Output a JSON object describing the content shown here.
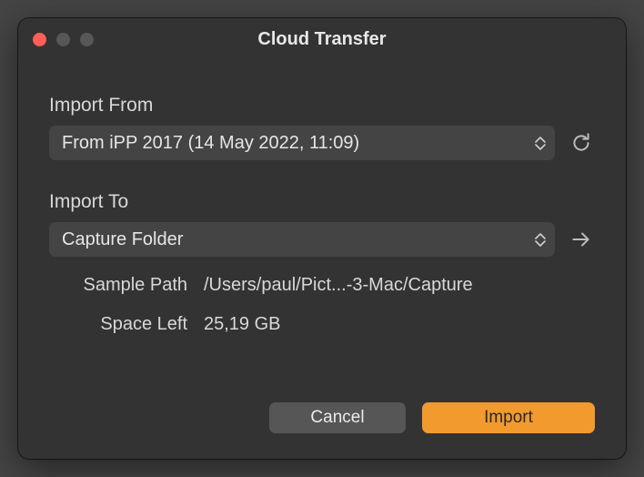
{
  "window": {
    "title": "Cloud Transfer"
  },
  "importFrom": {
    "label": "Import From",
    "selected": "From iPP 2017 (14 May 2022, 11:09)"
  },
  "importTo": {
    "label": "Import To",
    "selected": "Capture Folder"
  },
  "samplePath": {
    "label": "Sample Path",
    "value": "/Users/paul/Pict...-3-Mac/Capture"
  },
  "spaceLeft": {
    "label": "Space Left",
    "value": "25,19 GB"
  },
  "buttons": {
    "cancel": "Cancel",
    "import": "Import"
  },
  "colors": {
    "accent": "#f29a2e"
  }
}
